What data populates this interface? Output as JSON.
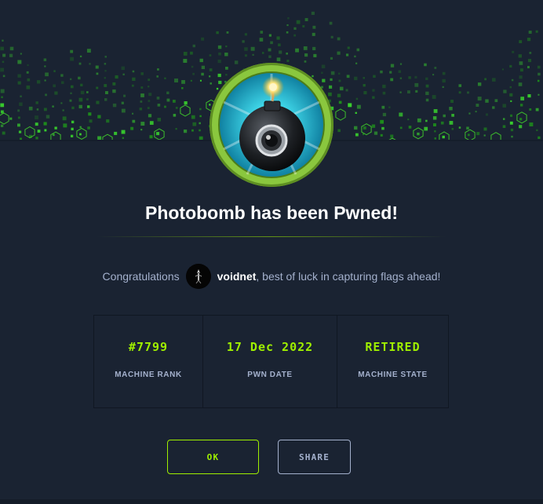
{
  "header": {
    "banner_icon": "green-hex-wave-banner",
    "machine_avatar_icon": "bomb-with-camera-lens-icon"
  },
  "title": "Photobomb has been Pwned!",
  "congrats": {
    "prefix": "Congratulations",
    "username": "voidnet",
    "suffix": ", best of luck in capturing flags ahead!",
    "user_avatar_icon": "user-avatar"
  },
  "stats": [
    {
      "value": "#7799",
      "label": "MACHINE RANK"
    },
    {
      "value": "17 Dec 2022",
      "label": "PWN DATE"
    },
    {
      "value": "RETIRED",
      "label": "MACHINE STATE"
    }
  ],
  "buttons": {
    "ok": "OK",
    "share": "SHARE"
  },
  "colors": {
    "background": "#1a2332",
    "accent_green": "#9fef00",
    "muted_text": "#a4b1cd",
    "avatar_ring": "#8ac73e"
  }
}
